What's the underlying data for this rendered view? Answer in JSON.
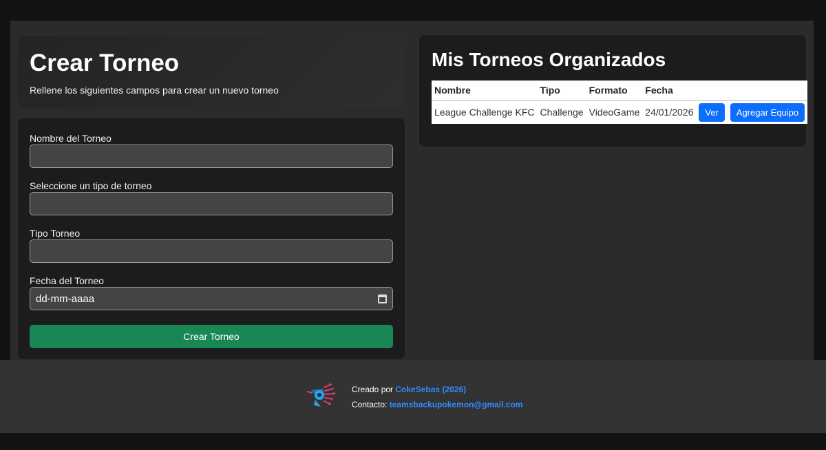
{
  "colors": {
    "accent": "#198754",
    "primary": "#0d6efd",
    "link": "#2f8cff"
  },
  "hero": {
    "title": "Crear Torneo",
    "subtitle": "Rellene los siguientes campos para crear un nuevo torneo"
  },
  "form": {
    "name_label": "Nombre del Torneo",
    "name_value": "",
    "type_select_label": "Seleccione un tipo de torneo",
    "type_select_value": "",
    "type_label": "Tipo Torneo",
    "type_value": "",
    "date_label": "Fecha del Torneo",
    "date_placeholder": "dd-mm-aaaa",
    "submit_label": "Crear Torneo"
  },
  "tournaments": {
    "title": "Mis Torneos Organizados",
    "headers": [
      "Nombre",
      "Tipo",
      "Formato",
      "Fecha"
    ],
    "rows": [
      {
        "nombre": "League Challenge KFC",
        "tipo": "Challenge",
        "formato": "VideoGame",
        "fecha": "24/01/2026",
        "view_label": "Ver",
        "add_team_label": "Agregar Equipo"
      }
    ]
  },
  "footer": {
    "created_by": "Creado por",
    "author": "CokeSebas",
    "year": "(2026)",
    "contact_label": "Contacto:",
    "email": "teamsbackupokemon@gmail.com"
  }
}
